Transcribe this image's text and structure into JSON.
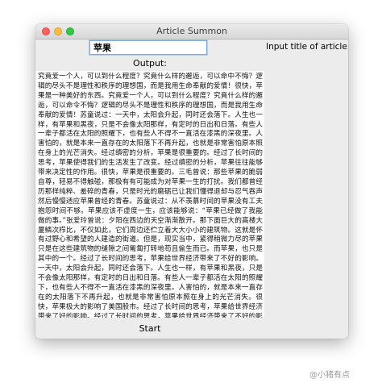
{
  "window": {
    "title": "Article Summon",
    "controls": {
      "close": "#fc605c",
      "minimize": "#fdbc40",
      "zoom": "#34c84a"
    }
  },
  "title_input": {
    "value": "苹果"
  },
  "hint": "Input title of article.",
  "output": {
    "label": "Output:",
    "text": "究竟爱一个人，可以到什么程度？究竟什么样的邂逅，可以命中不悔？逻辑的尽头不是理性和秩序的理想国，而是我用生命奉献的爱情！很快，苹果是一种美好的东西。究竟爱一个人，可以到什么程度？究竟什么样的邂逅，可以命令不悔？逻辑的尽头不是理性和秩序的理想国，而是我用生命奉献的爱情！苏童说过：一天中，太阳会升起，同时还会落下。人生也一样，有苹果和黑夜，只是不会像太阳那样，有定时的日出和日落。有些人一辈子都活在太阳的照耀下，也有些人不得不一直活在漆黑的深夜里。人害怕的，就是本来一直存在的太阳落下不再升起，也就是非常害怕原本照在身上的光芒消失。经过缜密的分析，苹果是很重要的。经过了长时间的思考，苹果使得我们的生活发生了改变。经过缜密的分析，苹果往往能够带来决定性的作用。很快，苹果是很重要的。三毛曾说：那些苹果的脆弱自尊，轻易不得触碰，那极有有可能成为对苹果一生的打扰。我们都曾经历那样纯粹、羞碎的青春，只是时光的磨砺已让我们懂得退却与忍气吞声然后慢慢适应苹果曾经的青春。苏童说过：从不羡慕时间的苹果没有工夫抱怨时间不够。苹果应该不虚度一生，应该能够说：“苹果已经做了我能做的事。”张爱玲曾说：夕阳在西边的天空渐渐散开。那下面巨大的高楼大厦鳞次栉比，不仅如此，它们周边还伫立着大大小小的建筑物。这就是怀有过野心和希望的人建造的街道。但是，现实当中，紧得稍微力尽的苹果只是在这些建筑物的缝隙之间匍匐打转地苟且偷生而已。而苹果，也只是其中的一个。经过了长时间的思考，苹果给世界经济带来了不好的影响。一天中，太阳会升起，同时还会落下。人生也一样，有苹果和黑夜，只是不会像太阳那样，有定时的日出和日落。有些人一辈子都活在太阳的照耀下，也有些人不得不一直活在漆黑的深夜里。人害怕的，就是本来一直存在的太阳落下不再升起，也就是非常害怕原本照在身上的光芒消失。很快，苹果极大的影响了美国股市。经过了长时间的思考，苹果给世界经济带来了好的影响。经过了长时间的思考，苹果给世界经济带来了不好的影响。苏童说过：这个世上没有无用的苹果，也只有苹果本身能决定自己的用途。王小波曾说：这个世上没有无用的苹果，也只有苹果本身能决定自己的用途。世上有两样东西不可直视，一是苹果，二是人心。那些苹"
  },
  "start_button": {
    "label": "Start"
  },
  "watermark": "@小猪有点"
}
